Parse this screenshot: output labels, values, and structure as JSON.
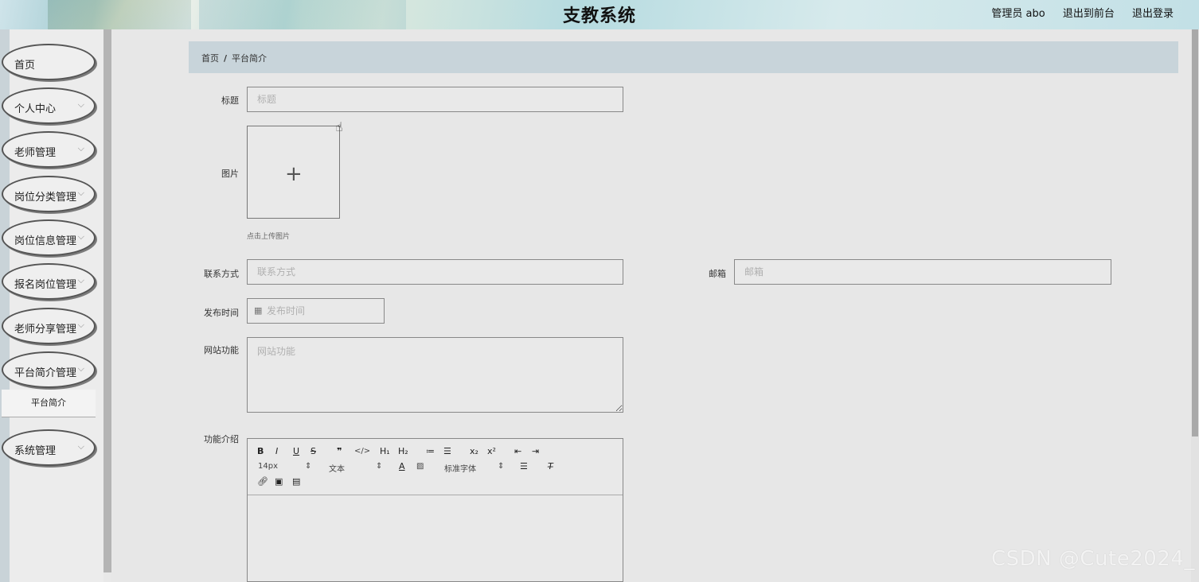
{
  "app": {
    "title": "支教系统"
  },
  "header": {
    "user": "管理员 abo",
    "to_front": "退出到前台",
    "logout": "退出登录"
  },
  "sidebar": {
    "items": [
      {
        "label": "首页",
        "has_chevron": false
      },
      {
        "label": "个人中心",
        "has_chevron": true
      },
      {
        "label": "老师管理",
        "has_chevron": true
      },
      {
        "label": "岗位分类管理",
        "has_chevron": true
      },
      {
        "label": "岗位信息管理",
        "has_chevron": true
      },
      {
        "label": "报名岗位管理",
        "has_chevron": true
      },
      {
        "label": "老师分享管理",
        "has_chevron": true
      },
      {
        "label": "平台简介管理",
        "has_chevron": true
      },
      {
        "label": "系统管理",
        "has_chevron": true
      }
    ],
    "submenu": {
      "label": "平台简介"
    }
  },
  "breadcrumb": {
    "home": "首页",
    "sep": "/",
    "current": "平台简介"
  },
  "form": {
    "title": {
      "label": "标题",
      "placeholder": "标题"
    },
    "image": {
      "label": "图片",
      "plus": "+",
      "tip": "点击上传图片"
    },
    "contact": {
      "label": "联系方式",
      "placeholder": "联系方式"
    },
    "email": {
      "label": "邮箱",
      "placeholder": "邮箱"
    },
    "publish_time": {
      "label": "发布时间",
      "placeholder": "发布时间"
    },
    "site_function": {
      "label": "网站功能",
      "placeholder": "网站功能"
    },
    "intro": {
      "label": "功能介绍"
    }
  },
  "editor": {
    "toolbar_row1": [
      "B",
      "I",
      "U",
      "S",
      "❞",
      "</>",
      "H₁",
      "H₂",
      "≔",
      "☰",
      "x₂",
      "x²",
      "⇤",
      "⇥"
    ],
    "font_size": "14px",
    "text_type": "文本",
    "font_family": "标准字体"
  },
  "watermark": "CSDN @Cute2024_"
}
